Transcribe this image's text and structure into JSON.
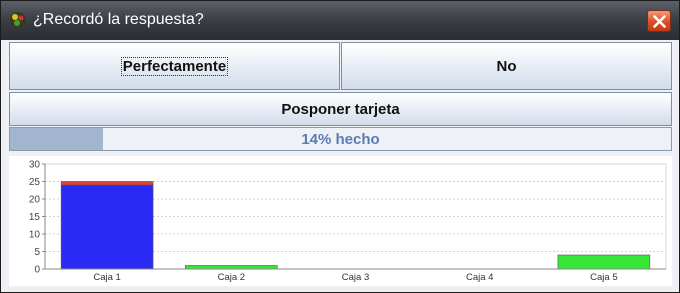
{
  "window": {
    "title": "¿Recordó la respuesta?"
  },
  "buttons": {
    "perfectamente": "Perfectamente",
    "no": "No",
    "posponer": "Posponer tarjeta"
  },
  "progress": {
    "fraction": 0.14,
    "label": "14% hecho"
  },
  "icons": {
    "app": "app-icon",
    "close": "close-icon"
  },
  "colors": {
    "bar_primary": "#2a2af5",
    "bar_red": "#e04040",
    "bar_green": "#36e636",
    "progress_text": "#5a7bb6"
  },
  "chart_data": {
    "type": "bar",
    "categories": [
      "Caja 1",
      "Caja 2",
      "Caja 3",
      "Caja 4",
      "Caja 5"
    ],
    "series": [
      {
        "values": [
          24,
          0,
          0,
          0,
          0
        ],
        "color": "#2a2af5"
      },
      {
        "values": [
          1,
          0,
          0,
          0,
          0
        ],
        "color": "#e04040"
      },
      {
        "values": [
          0,
          1,
          0,
          0,
          4
        ],
        "color": "#36e636"
      }
    ],
    "ylim": [
      0,
      30
    ],
    "yticks": [
      0,
      5,
      10,
      15,
      20,
      25,
      30
    ],
    "grid": true
  }
}
